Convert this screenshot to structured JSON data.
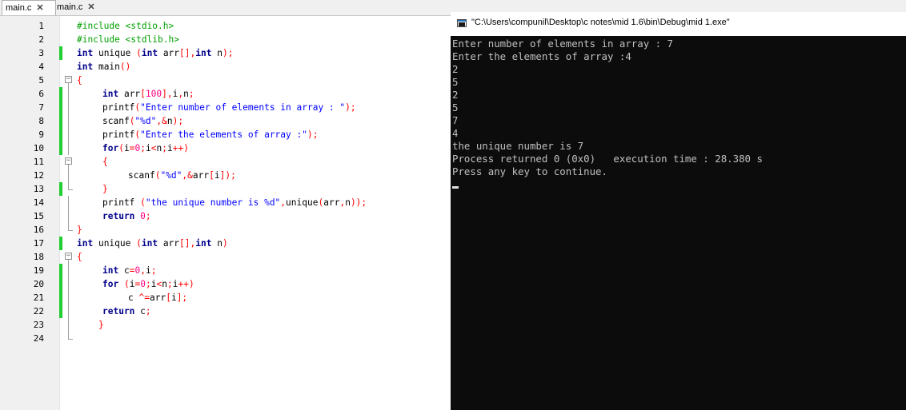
{
  "editor": {
    "tabs": [
      {
        "label": "main.c",
        "active": true
      },
      {
        "label": "main.c",
        "active": false
      }
    ],
    "tab_close_glyph": "✕",
    "lines": [
      {
        "n": "1",
        "changed": false,
        "fold": null,
        "indent": 0,
        "tokens": [
          {
            "t": "#include <stdio.h>",
            "c": "pp"
          }
        ]
      },
      {
        "n": "2",
        "changed": false,
        "fold": null,
        "indent": 0,
        "tokens": [
          {
            "t": "#include <stdlib.h>",
            "c": "pp"
          }
        ]
      },
      {
        "n": "3",
        "changed": true,
        "fold": null,
        "indent": 0,
        "tokens": [
          {
            "t": "int",
            "c": "kw"
          },
          {
            "t": " unique ",
            "c": "id"
          },
          {
            "t": "(",
            "c": "op"
          },
          {
            "t": "int",
            "c": "kw"
          },
          {
            "t": " arr",
            "c": "id"
          },
          {
            "t": "[],",
            "c": "op"
          },
          {
            "t": "int",
            "c": "kw"
          },
          {
            "t": " n",
            "c": "id"
          },
          {
            "t": ");",
            "c": "op"
          }
        ]
      },
      {
        "n": "4",
        "changed": false,
        "fold": null,
        "indent": 0,
        "tokens": [
          {
            "t": "int",
            "c": "kw"
          },
          {
            "t": " main",
            "c": "id"
          },
          {
            "t": "()",
            "c": "op"
          }
        ]
      },
      {
        "n": "5",
        "changed": false,
        "fold": "open",
        "indent": 0,
        "tokens": [
          {
            "t": "{",
            "c": "op"
          }
        ]
      },
      {
        "n": "6",
        "changed": true,
        "fold": "line",
        "indent": 1,
        "tokens": [
          {
            "t": "int",
            "c": "kw"
          },
          {
            "t": " arr",
            "c": "id"
          },
          {
            "t": "[",
            "c": "op"
          },
          {
            "t": "100",
            "c": "num"
          },
          {
            "t": "],",
            "c": "op"
          },
          {
            "t": "i",
            "c": "id"
          },
          {
            "t": ",",
            "c": "op"
          },
          {
            "t": "n",
            "c": "id"
          },
          {
            "t": ";",
            "c": "op"
          }
        ]
      },
      {
        "n": "7",
        "changed": true,
        "fold": "line",
        "indent": 1,
        "tokens": [
          {
            "t": "printf",
            "c": "id"
          },
          {
            "t": "(",
            "c": "op"
          },
          {
            "t": "\"Enter number of elements in array : \"",
            "c": "str"
          },
          {
            "t": ");",
            "c": "op"
          }
        ]
      },
      {
        "n": "8",
        "changed": true,
        "fold": "line",
        "indent": 1,
        "tokens": [
          {
            "t": "scanf",
            "c": "id"
          },
          {
            "t": "(",
            "c": "op"
          },
          {
            "t": "\"%d\"",
            "c": "str"
          },
          {
            "t": ",&",
            "c": "op"
          },
          {
            "t": "n",
            "c": "id"
          },
          {
            "t": ");",
            "c": "op"
          }
        ]
      },
      {
        "n": "9",
        "changed": true,
        "fold": "line",
        "indent": 1,
        "tokens": [
          {
            "t": "printf",
            "c": "id"
          },
          {
            "t": "(",
            "c": "op"
          },
          {
            "t": "\"Enter the elements of array :\"",
            "c": "str"
          },
          {
            "t": ");",
            "c": "op"
          }
        ]
      },
      {
        "n": "10",
        "changed": true,
        "fold": "line",
        "indent": 1,
        "tokens": [
          {
            "t": "for",
            "c": "kw"
          },
          {
            "t": "(",
            "c": "op"
          },
          {
            "t": "i",
            "c": "id"
          },
          {
            "t": "=",
            "c": "op"
          },
          {
            "t": "0",
            "c": "num"
          },
          {
            "t": ";",
            "c": "op"
          },
          {
            "t": "i",
            "c": "id"
          },
          {
            "t": "<",
            "c": "op"
          },
          {
            "t": "n",
            "c": "id"
          },
          {
            "t": ";",
            "c": "op"
          },
          {
            "t": "i",
            "c": "id"
          },
          {
            "t": "++)",
            "c": "op"
          }
        ]
      },
      {
        "n": "11",
        "changed": false,
        "fold": "open",
        "indent": 1,
        "tokens": [
          {
            "t": "{",
            "c": "op"
          }
        ]
      },
      {
        "n": "12",
        "changed": false,
        "fold": "line",
        "indent": 2,
        "tokens": [
          {
            "t": "scanf",
            "c": "id"
          },
          {
            "t": "(",
            "c": "op"
          },
          {
            "t": "\"%d\"",
            "c": "str"
          },
          {
            "t": ",&",
            "c": "op"
          },
          {
            "t": "arr",
            "c": "id"
          },
          {
            "t": "[",
            "c": "op"
          },
          {
            "t": "i",
            "c": "id"
          },
          {
            "t": "]);",
            "c": "op"
          }
        ]
      },
      {
        "n": "13",
        "changed": true,
        "fold": "end",
        "indent": 1,
        "tokens": [
          {
            "t": "}",
            "c": "op"
          }
        ]
      },
      {
        "n": "14",
        "changed": false,
        "fold": "line",
        "indent": 1,
        "tokens": [
          {
            "t": "printf ",
            "c": "id"
          },
          {
            "t": "(",
            "c": "op"
          },
          {
            "t": "\"the unique number is %d\"",
            "c": "str"
          },
          {
            "t": ",",
            "c": "op"
          },
          {
            "t": "unique",
            "c": "id"
          },
          {
            "t": "(",
            "c": "op"
          },
          {
            "t": "arr",
            "c": "id"
          },
          {
            "t": ",",
            "c": "op"
          },
          {
            "t": "n",
            "c": "id"
          },
          {
            "t": "));",
            "c": "op"
          }
        ]
      },
      {
        "n": "15",
        "changed": false,
        "fold": "line",
        "indent": 1,
        "tokens": [
          {
            "t": "return",
            "c": "kw"
          },
          {
            "t": " ",
            "c": "id"
          },
          {
            "t": "0",
            "c": "num"
          },
          {
            "t": ";",
            "c": "op"
          }
        ]
      },
      {
        "n": "16",
        "changed": false,
        "fold": "end",
        "indent": 0,
        "tokens": [
          {
            "t": "}",
            "c": "op"
          }
        ]
      },
      {
        "n": "17",
        "changed": true,
        "fold": null,
        "indent": 0,
        "tokens": [
          {
            "t": "int",
            "c": "kw"
          },
          {
            "t": " unique ",
            "c": "id"
          },
          {
            "t": "(",
            "c": "op"
          },
          {
            "t": "int",
            "c": "kw"
          },
          {
            "t": " arr",
            "c": "id"
          },
          {
            "t": "[],",
            "c": "op"
          },
          {
            "t": "int",
            "c": "kw"
          },
          {
            "t": " n",
            "c": "id"
          },
          {
            "t": ")",
            "c": "op"
          }
        ]
      },
      {
        "n": "18",
        "changed": false,
        "fold": "open",
        "indent": 0,
        "tokens": [
          {
            "t": "{",
            "c": "op"
          }
        ]
      },
      {
        "n": "19",
        "changed": true,
        "fold": "line",
        "indent": 1,
        "tokens": [
          {
            "t": "int",
            "c": "kw"
          },
          {
            "t": " c",
            "c": "id"
          },
          {
            "t": "=",
            "c": "op"
          },
          {
            "t": "0",
            "c": "num"
          },
          {
            "t": ",",
            "c": "op"
          },
          {
            "t": "i",
            "c": "id"
          },
          {
            "t": ";",
            "c": "op"
          }
        ]
      },
      {
        "n": "20",
        "changed": true,
        "fold": "line",
        "indent": 1,
        "tokens": [
          {
            "t": "for",
            "c": "kw"
          },
          {
            "t": " ",
            "c": "id"
          },
          {
            "t": "(",
            "c": "op"
          },
          {
            "t": "i",
            "c": "id"
          },
          {
            "t": "=",
            "c": "op"
          },
          {
            "t": "0",
            "c": "num"
          },
          {
            "t": ";",
            "c": "op"
          },
          {
            "t": "i",
            "c": "id"
          },
          {
            "t": "<",
            "c": "op"
          },
          {
            "t": "n",
            "c": "id"
          },
          {
            "t": ";",
            "c": "op"
          },
          {
            "t": "i",
            "c": "id"
          },
          {
            "t": "++)",
            "c": "op"
          }
        ]
      },
      {
        "n": "21",
        "changed": true,
        "fold": "line",
        "indent": 2,
        "tokens": [
          {
            "t": "c ",
            "c": "id"
          },
          {
            "t": "^=",
            "c": "op"
          },
          {
            "t": "arr",
            "c": "id"
          },
          {
            "t": "[",
            "c": "op"
          },
          {
            "t": "i",
            "c": "id"
          },
          {
            "t": "];",
            "c": "op"
          }
        ]
      },
      {
        "n": "22",
        "changed": true,
        "fold": "line",
        "indent": 1,
        "tokens": [
          {
            "t": "return",
            "c": "kw"
          },
          {
            "t": " c",
            "c": "id"
          },
          {
            "t": ";",
            "c": "op"
          }
        ]
      },
      {
        "n": "23",
        "changed": false,
        "fold": "line",
        "indent": 0,
        "tokens": [
          {
            "t": "    }",
            "c": "op"
          }
        ]
      },
      {
        "n": "24",
        "changed": false,
        "fold": "end",
        "indent": 0,
        "tokens": []
      }
    ]
  },
  "console": {
    "title": "\"C:\\Users\\compunil\\Desktop\\c notes\\mid 1.6\\bin\\Debug\\mid 1.exe\"",
    "lines": [
      "Enter number of elements in array : 7",
      "Enter the elements of array :4",
      "2",
      "5",
      "2",
      "5",
      "7",
      "4",
      "the unique number is 7",
      "Process returned 0 (0x0)   execution time : 28.380 s",
      "Press any key to continue."
    ]
  },
  "colors": {
    "keyword": "#00008b",
    "preprocessor": "#00a000",
    "string": "#0000ff",
    "number": "#ff0080",
    "operator": "#ff0000",
    "changebar": "#22cc33",
    "console_bg": "#0c0c0c",
    "console_text": "#c0c0c0"
  }
}
